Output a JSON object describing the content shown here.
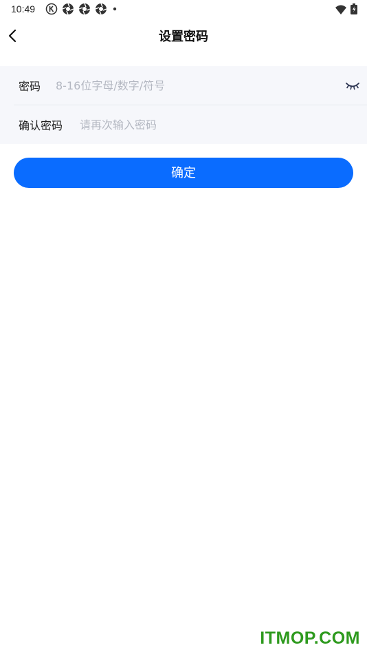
{
  "status_bar": {
    "time": "10:49",
    "left_icons": [
      "k-circle-icon",
      "aperture-icon",
      "aperture-icon",
      "aperture-icon",
      "dot-icon"
    ],
    "right_icons": [
      "wifi-icon",
      "battery-charging-icon"
    ]
  },
  "header": {
    "title": "设置密码",
    "back_icon": "chevron-left-icon"
  },
  "form": {
    "password": {
      "label": "密码",
      "value": "",
      "placeholder": "8-16位字母/数字/符号",
      "toggle_icon": "eye-closed-icon"
    },
    "confirm": {
      "label": "确认密码",
      "value": "",
      "placeholder": "请再次输入密码"
    }
  },
  "actions": {
    "submit_label": "确定"
  },
  "watermark": "ITMOP.COM",
  "colors": {
    "accent": "#0a6cff",
    "form_background": "#f6f7fb",
    "placeholder": "#b4b8c2",
    "watermark": "#2e9a1e"
  }
}
